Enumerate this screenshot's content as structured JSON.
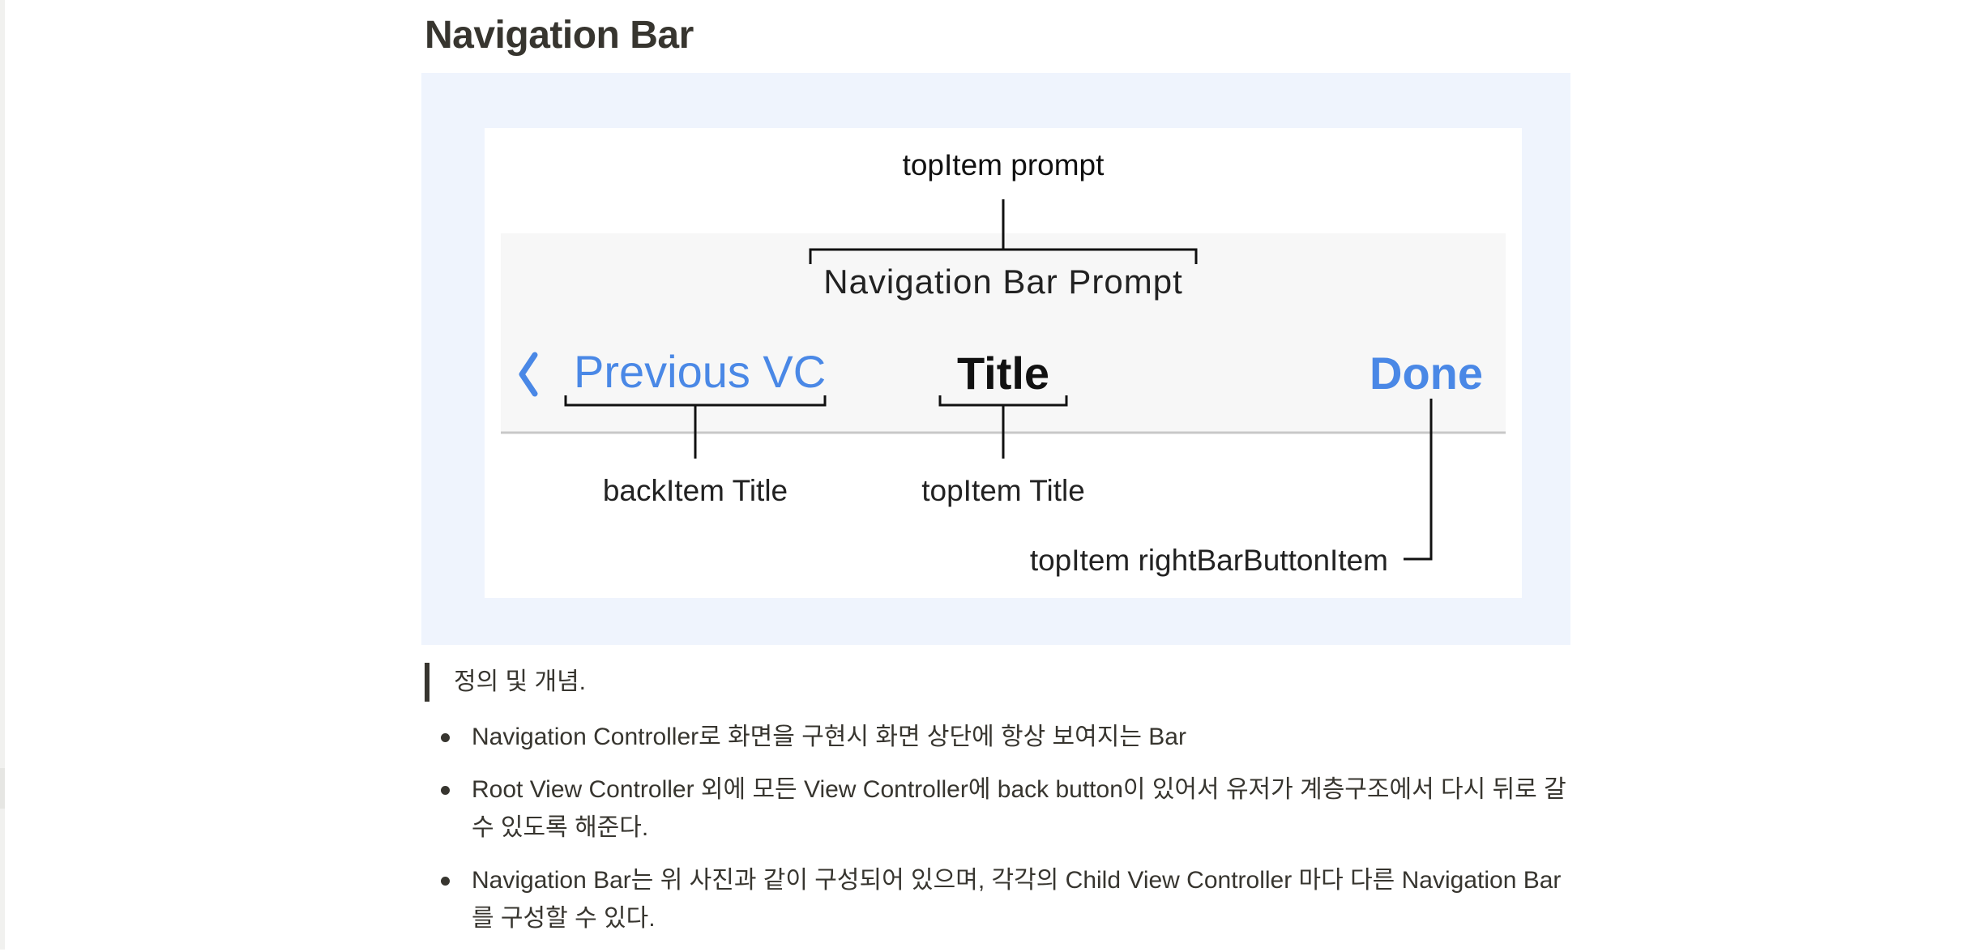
{
  "page": {
    "heading": "Navigation Bar"
  },
  "diagram": {
    "prompt_caption": "topItem prompt",
    "prompt_text": "Navigation Bar Prompt",
    "back_label": "Previous VC",
    "title_label": "Title",
    "done_label": "Done",
    "back_caption": "backItem Title",
    "title_caption": "topItem Title",
    "right_caption": "topItem rightBarButtonItem",
    "colors": {
      "accent": "#4a88e6",
      "bar_background": "#f7f7f7",
      "separator": "#c8c8c8",
      "line": "#111111"
    }
  },
  "quote": {
    "text": "정의 및 개념."
  },
  "bullets": [
    {
      "text": "Navigation Controller로 화면을 구현시 화면 상단에 항상 보여지는 Bar"
    },
    {
      "text": "Root View Controller 외에 모든 View Controller에 back button이 있어서 유저가 계층구조에서 다시 뒤로 갈 수 있도록 해준다."
    },
    {
      "text": "Navigation Bar는 위 사진과 같이 구성되어 있으며, 각각의 Child View Controller 마다 다른 Navigation Bar를 구성할 수 있다."
    }
  ]
}
